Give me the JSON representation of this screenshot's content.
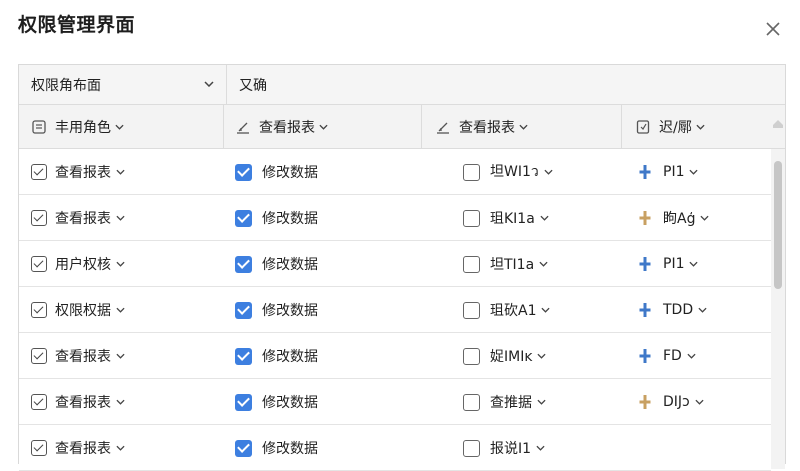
{
  "dialog": {
    "title": "权限管理界面"
  },
  "toolbar": {
    "role_select_label": "权限角布面",
    "confirm_label": "又确"
  },
  "columns": [
    {
      "label": "丰用角色",
      "icon": "id-badge-icon"
    },
    {
      "label": "查看报表",
      "icon": "chart-icon"
    },
    {
      "label": "查看报表",
      "icon": "chart-icon"
    },
    {
      "label": "迟/鄏",
      "icon": "doc-icon"
    }
  ],
  "rows": [
    {
      "role": "查看报表",
      "perm": "修改数据",
      "extra": "坦WI1ว",
      "tag": "PI1",
      "tag_color": "#3f78c8"
    },
    {
      "role": "查看报表",
      "perm": "修改数据",
      "extra": "珇KI1a",
      "tag": "眗Aģ",
      "tag_color": "#c8a062"
    },
    {
      "role": "用户权核",
      "perm": "修改数据",
      "extra": "坦TI1a",
      "tag": "PI1",
      "tag_color": "#3f78c8"
    },
    {
      "role": "权限权据",
      "perm": "修改数据",
      "extra": "珇砍A1",
      "tag": "TDD",
      "tag_color": "#3f78c8"
    },
    {
      "role": "查看报表",
      "perm": "修改数据",
      "extra": "娖IMIĸ",
      "tag": "FD",
      "tag_color": "#3f78c8"
    },
    {
      "role": "查看报表",
      "perm": "修改数据",
      "extra": "查推据",
      "tag": "DIJɔ",
      "tag_color": "#c8a062"
    },
    {
      "role": "查看报表",
      "perm": "修改数据",
      "extra": "报说I1",
      "tag": "",
      "tag_color": "#3f78c8"
    }
  ],
  "colors": {
    "accent": "#3d7fe0",
    "border": "#dcdcdc"
  }
}
